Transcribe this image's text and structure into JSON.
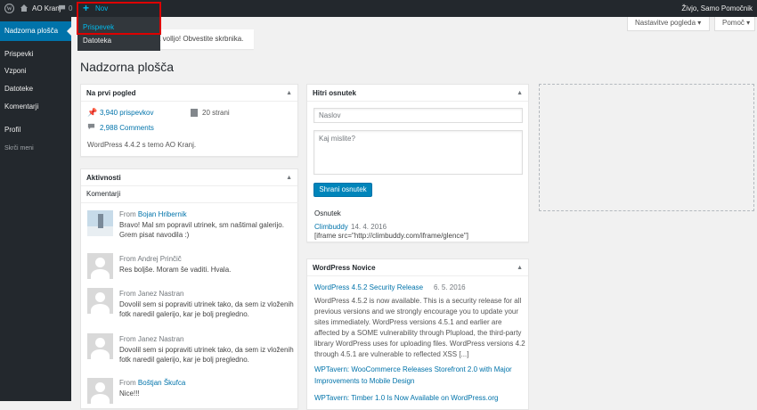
{
  "adminbar": {
    "wp_logo": "wordpress-icon",
    "site_name": "AO Kranj",
    "comments_count": "0",
    "new_label": "Nov",
    "greeting": "Živjo, Samo Pomočnik"
  },
  "new_menu": {
    "items": [
      {
        "label": "Prispevek"
      },
      {
        "label": "Datoteka"
      }
    ]
  },
  "sidebar": {
    "items": [
      {
        "label": "Nadzorna plošča"
      },
      {
        "label": "Prispevki"
      },
      {
        "label": "Vzponi"
      },
      {
        "label": "Datoteke"
      },
      {
        "label": "Komentarji"
      },
      {
        "label": "Profil"
      },
      {
        "label": "Skrči meni"
      }
    ]
  },
  "screen_options": "Nastavitve pogleda",
  "help": "Pomoč",
  "notice": "a volljo! Obvestite skrbnika.",
  "page_title": "Nadzorna plošča",
  "glance": {
    "title": "Na prvi pogled",
    "posts": "3,940 prispevkov",
    "pages": "20 strani",
    "comments": "2,988 Comments",
    "footer": "WordPress 4.4.2 s temo AO Kranj."
  },
  "activity": {
    "title": "Aktivnosti",
    "subtitle": "Komentarji",
    "comments": [
      {
        "from": "From",
        "author": "Bojan Hribernik",
        "text": "Bravo! Mal sm popravil utrinek, sm naštimal galerijo. Grem pisat navodila :)"
      },
      {
        "from": "From Andrej Prinčič",
        "text": "Res boljše. Moram še vaditi. Hvala."
      },
      {
        "from": "From Janez Nastran",
        "text": "Dovolil sem si popraviti utrinek tako, da sem iz vloženih fotk naredil galerijo, kar je bolj pregledno."
      },
      {
        "from": "From Janez Nastran",
        "text": "Dovolil sem si popraviti utrinek tako, da sem iz vloženih fotk naredil galerijo, kar je bolj pregledno."
      },
      {
        "from": "From",
        "author": "Boštjan Škufca",
        "text": "Nice!!!"
      }
    ]
  },
  "quick_draft": {
    "title": "Hitri osnutek",
    "title_placeholder": "Naslov",
    "content_placeholder": "Kaj mislite?",
    "save_button": "Shrani osnutek",
    "drafts_heading": "Osnutek",
    "draft_title": "Climbuddy",
    "draft_date": "14. 4. 2016",
    "draft_excerpt": "[iframe src=\"http://climbuddy.com/iframe/glence\"]"
  },
  "news": {
    "title": "WordPress Novice",
    "items": [
      {
        "title": "WordPress 4.5.2 Security Release",
        "date": "6. 5. 2016",
        "lines": [
          "WordPress 4.5.2 is now available. This is a security release for all",
          "previous versions and we strongly encourage you to update your",
          "sites immediately. WordPress versions 4.5.1 and earlier are",
          "affected by a SOME vulnerability through Plupload, the third-party",
          "library WordPress uses for uploading files. WordPress versions 4.2",
          "through 4.5.1 are vulnerable to reflected XSS [...]"
        ]
      },
      {
        "title_lines": [
          "WPTavern: WooCommerce Releases Storefront 2.0 with Major",
          "Improvements to Mobile Design"
        ]
      },
      {
        "title": "WPTavern: Timber 1.0 Is Now Available on WordPress.org"
      }
    ]
  }
}
